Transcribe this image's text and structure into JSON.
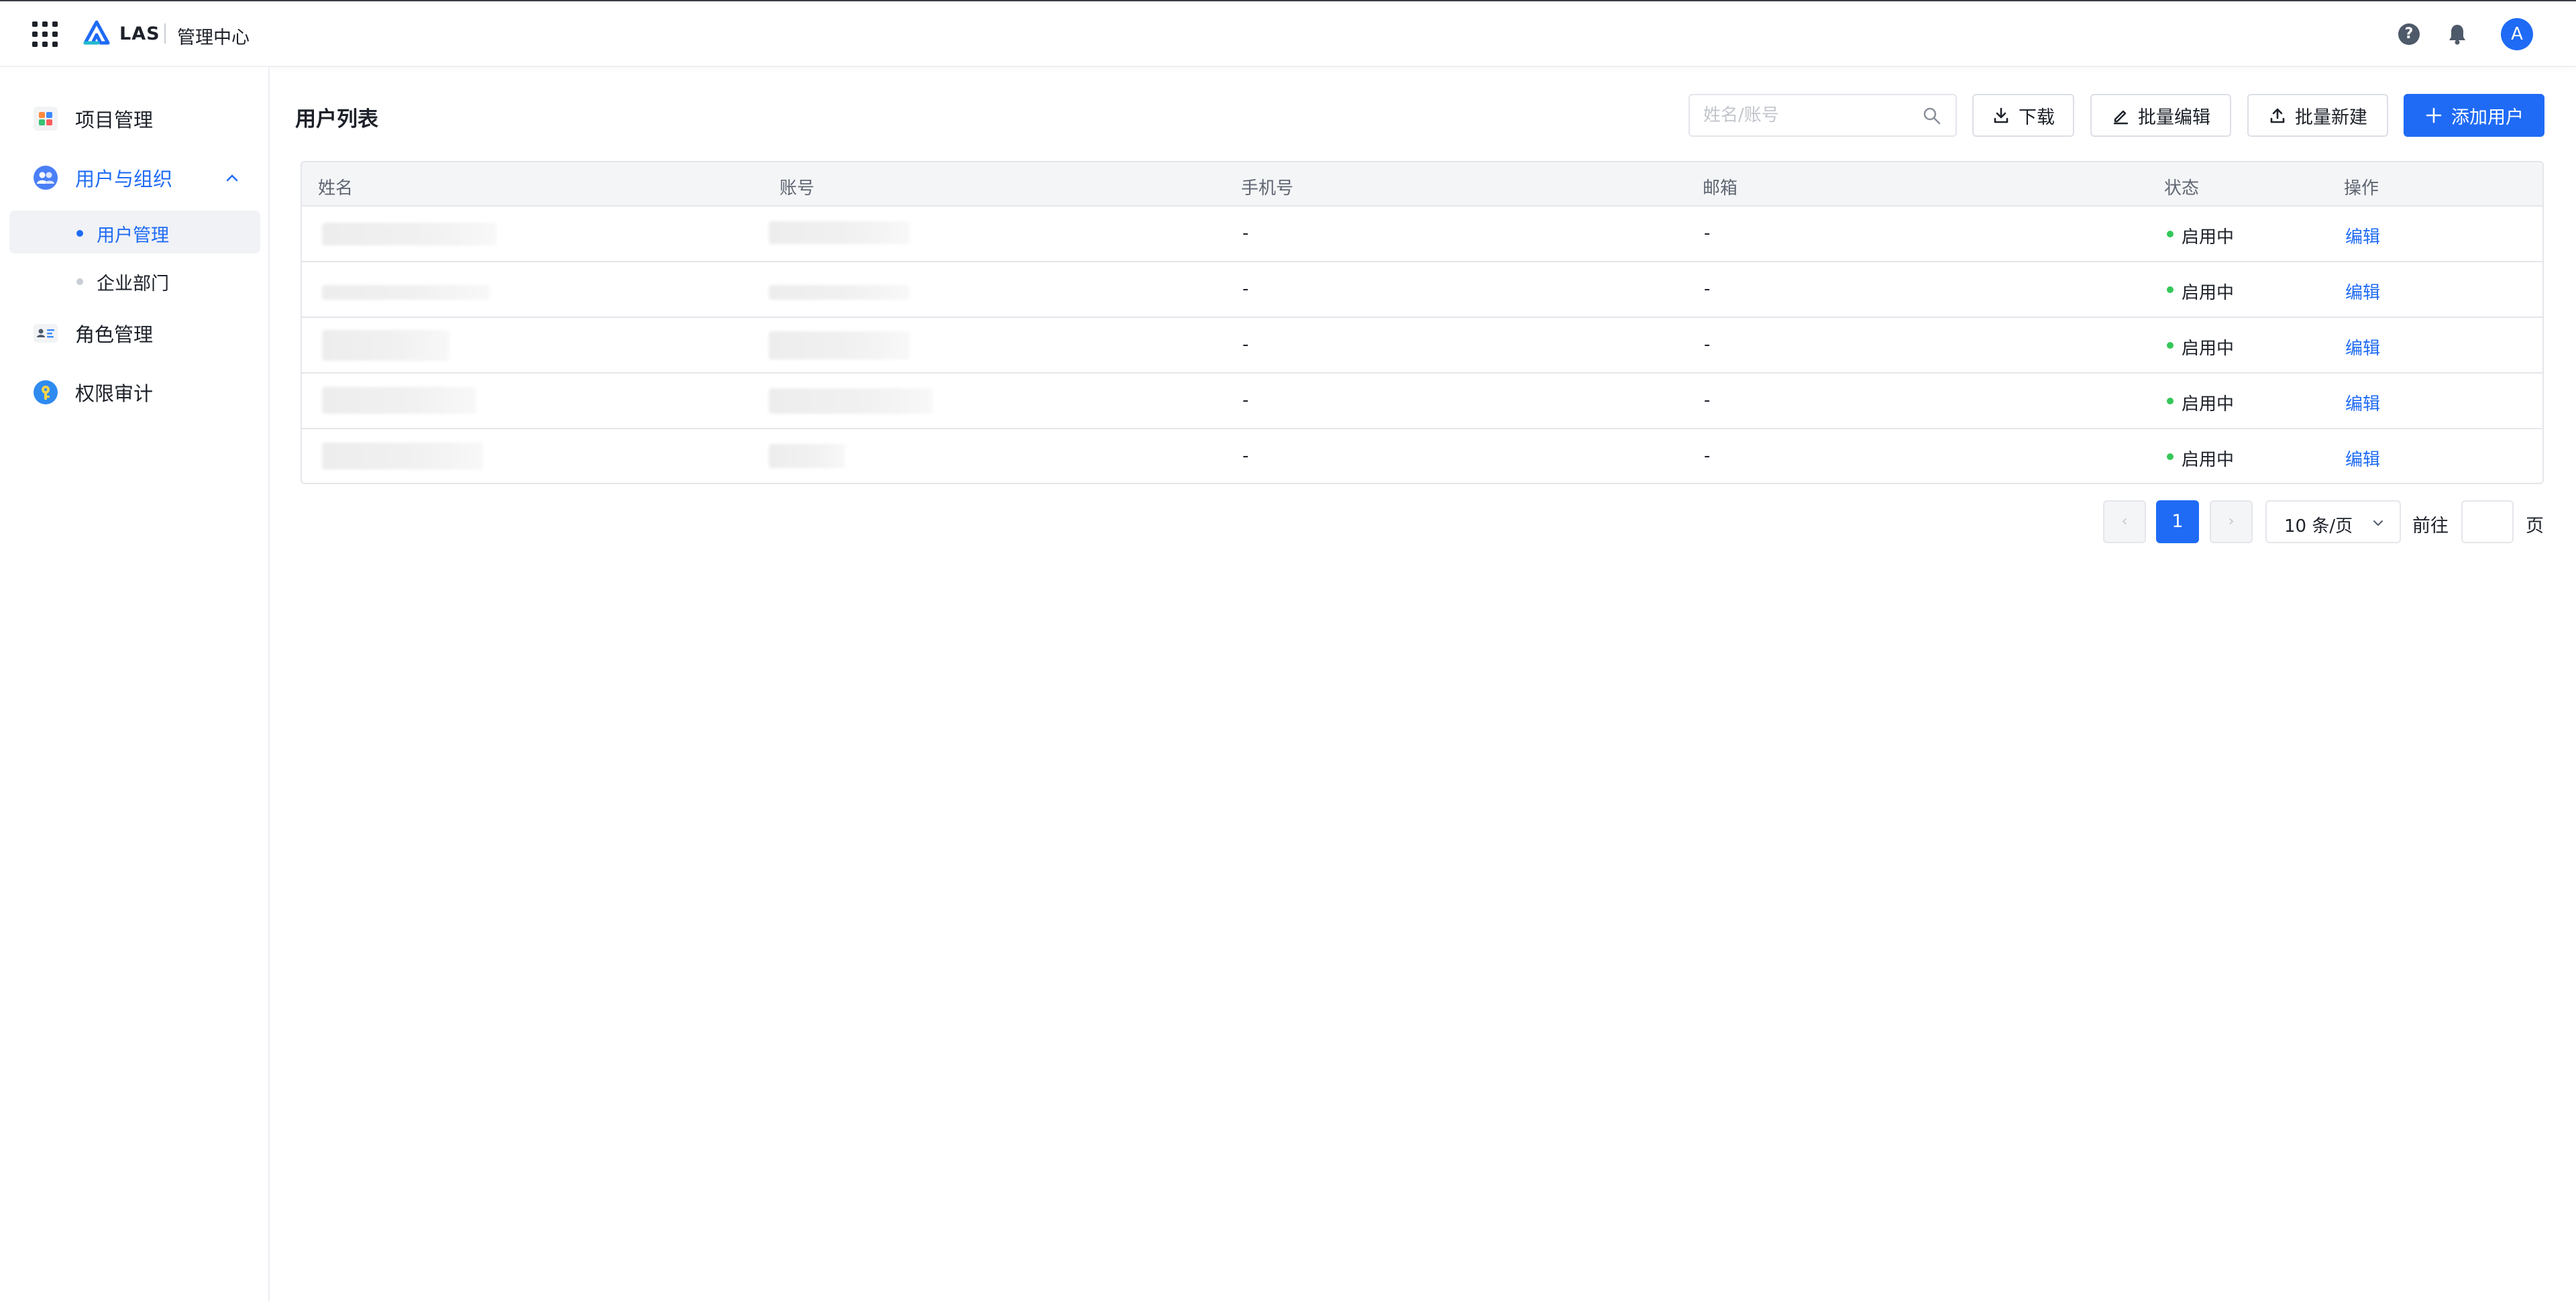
{
  "header": {
    "brand": "LAS",
    "subtitle": "管理中心",
    "avatar_letter": "A"
  },
  "sidebar": {
    "items": [
      {
        "label": "项目管理",
        "icon": "grid-apps-icon"
      },
      {
        "label": "用户与组织",
        "icon": "users-icon",
        "expanded": true,
        "children": [
          {
            "label": "用户管理",
            "active": true
          },
          {
            "label": "企业部门",
            "active": false
          }
        ]
      },
      {
        "label": "角色管理",
        "icon": "id-card-icon"
      },
      {
        "label": "权限审计",
        "icon": "audit-key-icon"
      }
    ]
  },
  "main": {
    "title": "用户列表",
    "search_placeholder": "姓名/账号",
    "buttons": {
      "download": "下载",
      "batch_edit": "批量编辑",
      "batch_create": "批量新建",
      "add_user": "添加用户"
    },
    "table": {
      "columns": [
        "姓名",
        "账号",
        "手机号",
        "邮箱",
        "状态",
        "操作"
      ],
      "rows": [
        {
          "name": "",
          "account": "",
          "phone": "-",
          "email": "-",
          "status": "启用中",
          "action": "编辑"
        },
        {
          "name": "",
          "account": "",
          "phone": "-",
          "email": "-",
          "status": "启用中",
          "action": "编辑"
        },
        {
          "name": "",
          "account": "",
          "phone": "-",
          "email": "-",
          "status": "启用中",
          "action": "编辑"
        },
        {
          "name": "",
          "account": "",
          "phone": "-",
          "email": "-",
          "status": "启用中",
          "action": "编辑"
        },
        {
          "name": "",
          "account": "",
          "phone": "-",
          "email": "-",
          "status": "启用中",
          "action": "编辑"
        }
      ]
    },
    "pagination": {
      "current_page": "1",
      "page_size": "10 条/页",
      "goto_label": "前往",
      "page_label": "页",
      "prev_symbol": "‹",
      "next_symbol": "›"
    }
  },
  "colors": {
    "accent": "#1f6bf5",
    "status_active": "#34c759"
  }
}
